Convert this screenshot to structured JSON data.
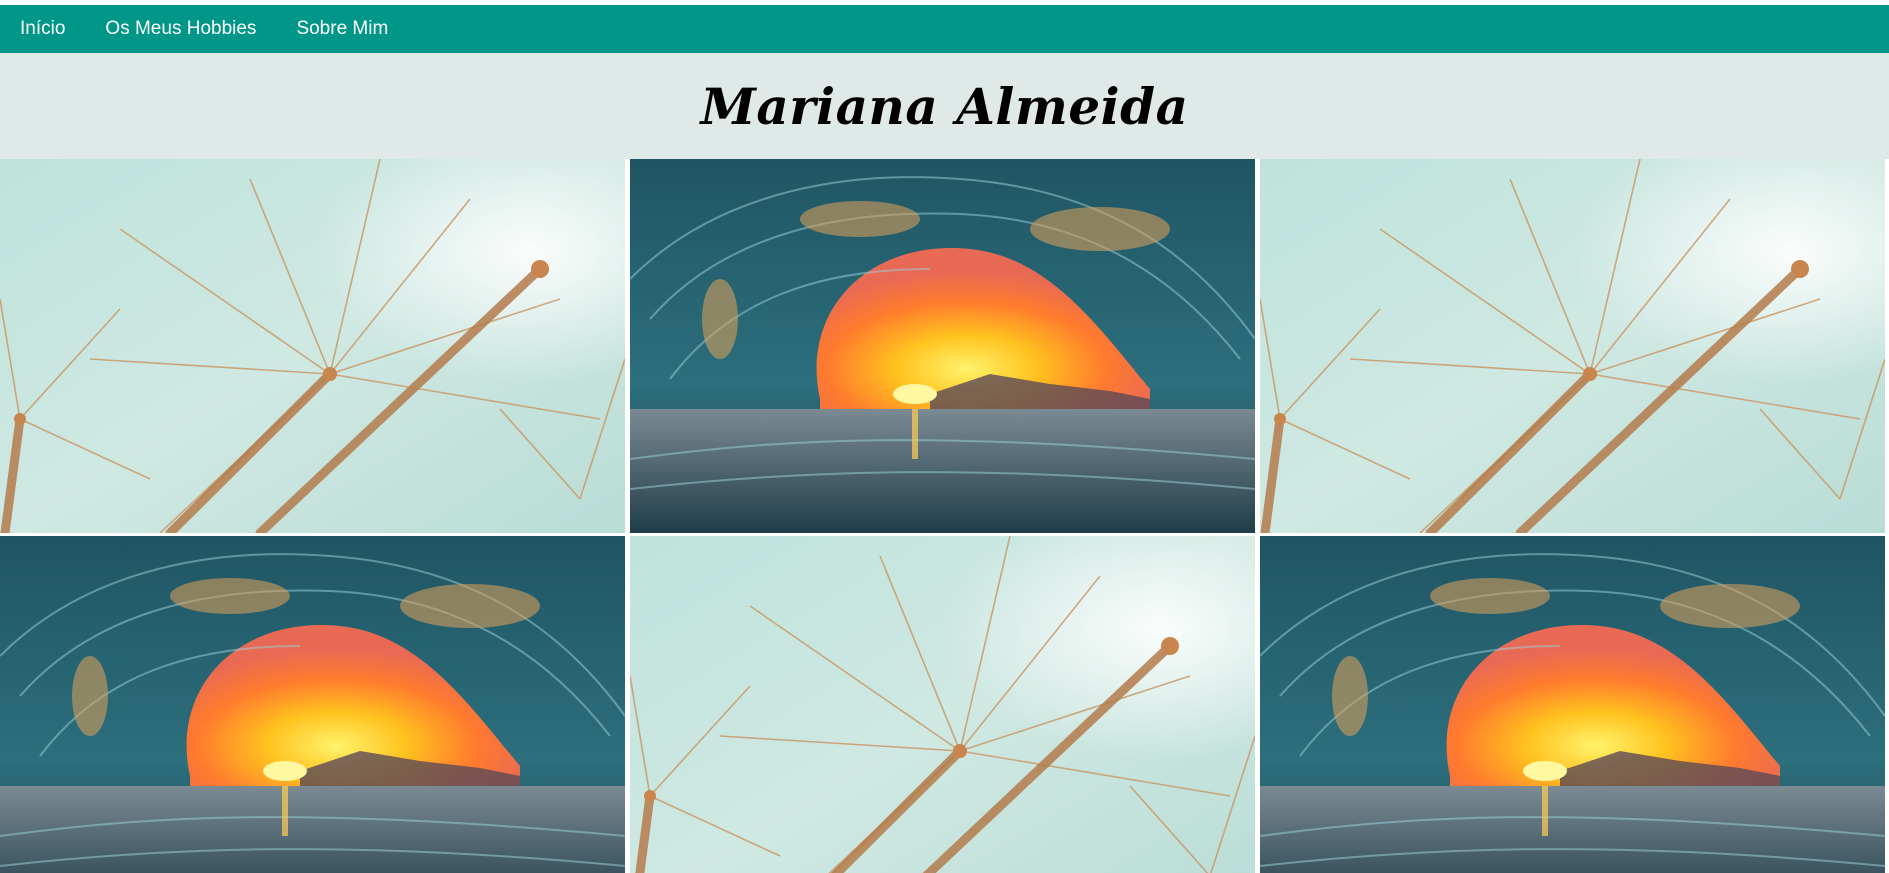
{
  "nav": {
    "items": [
      {
        "label": "Início"
      },
      {
        "label": "Os Meus Hobbies"
      },
      {
        "label": "Sobre Mim"
      }
    ]
  },
  "header": {
    "title": "Mariana Almeida"
  },
  "gallery": {
    "images": [
      {
        "subject": "dandelion-seeds-photo"
      },
      {
        "subject": "ocean-wave-sunset-photo"
      },
      {
        "subject": "dandelion-seeds-photo"
      },
      {
        "subject": "ocean-wave-sunset-photo"
      },
      {
        "subject": "dandelion-seeds-photo"
      },
      {
        "subject": "ocean-wave-sunset-photo"
      }
    ]
  },
  "colors": {
    "nav_bg": "#009688",
    "header_bg": "#dfe9e8",
    "nav_text": "#ffffff",
    "title_text": "#000000"
  }
}
